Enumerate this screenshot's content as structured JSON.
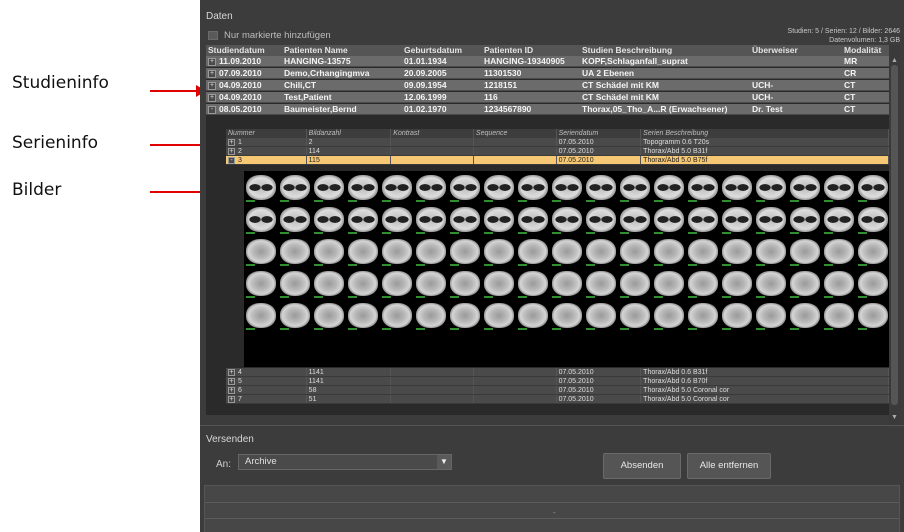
{
  "annotations": {
    "studieninfo": "Studieninfo",
    "serieninfo": "Serieninfo",
    "bilder": "Bilder"
  },
  "panel": {
    "data_title": "Daten",
    "checkbox_label": "Nur markierte hinzufügen",
    "stats_line1": "Studien: 5  /  Serien: 12  /  Bilder: 2646",
    "stats_line2": "Datenvolumen: 1,3 GB"
  },
  "study_table": {
    "headers": [
      "Studiendatum",
      "Patienten Name",
      "Geburtsdatum",
      "Patienten ID",
      "Studien Beschreibung",
      "Überweiser",
      "Modalität"
    ],
    "rows": [
      {
        "expander": "+",
        "date": "11.09.2010",
        "name": "HANGING-13575",
        "dob": "01.01.1934",
        "pid": "HANGING-19340905",
        "desc": "KOPF,Schlaganfall_suprat",
        "ref": "",
        "mod": "MR"
      },
      {
        "expander": "+",
        "date": "07.09.2010",
        "name": "Demo,Crhangingmva",
        "dob": "20.09.2005",
        "pid": "11301530",
        "desc": "UA 2 Ebenen",
        "ref": "",
        "mod": "CR"
      },
      {
        "expander": "+",
        "date": "04.09.2010",
        "name": "Chili,CT",
        "dob": "09.09.1954",
        "pid": "1218151",
        "desc": "CT Schädel mit KM",
        "ref": "UCH-",
        "mod": "CT"
      },
      {
        "expander": "+",
        "date": "04.09.2010",
        "name": "Test,Patient",
        "dob": "12.06.1999",
        "pid": "116",
        "desc": "CT Schädel mit KM",
        "ref": "UCH-",
        "mod": "CT"
      },
      {
        "expander": "-",
        "date": "08.05.2010",
        "name": "Baumeister,Bernd",
        "dob": "01.02.1970",
        "pid": "1234567890",
        "desc": "Thorax,05_Tho_A...R (Erwachsener)",
        "ref": "Dr. Test",
        "mod": "CT"
      }
    ]
  },
  "series_table": {
    "headers": [
      "Nummer",
      "Bildanzahl",
      "Kontrast",
      "Sequence",
      "Seriendatum",
      "Serien Beschreibung"
    ],
    "rows_top": [
      {
        "expander": "+",
        "num": "1",
        "count": "2",
        "contrast": "",
        "seq": "",
        "date": "07.05.2010",
        "desc": "Topogramm  0.6  T20s",
        "selected": false
      },
      {
        "expander": "+",
        "num": "2",
        "count": "114",
        "contrast": "",
        "seq": "",
        "date": "07.05.2010",
        "desc": "Thorax/Abd  5.0  B31f",
        "selected": false
      },
      {
        "expander": "-",
        "num": "3",
        "count": "115",
        "contrast": "",
        "seq": "",
        "date": "07.05.2010",
        "desc": "Thorax/Abd  5.0  B75f",
        "selected": true
      }
    ],
    "rows_bottom": [
      {
        "expander": "+",
        "num": "4",
        "count": "1141",
        "contrast": "",
        "seq": "",
        "date": "07.05.2010",
        "desc": "Thorax/Abd  0.6  B31f"
      },
      {
        "expander": "+",
        "num": "5",
        "count": "1141",
        "contrast": "",
        "seq": "",
        "date": "07.05.2010",
        "desc": "Thorax/Abd  0.6  B70f"
      },
      {
        "expander": "+",
        "num": "6",
        "count": "58",
        "contrast": "",
        "seq": "",
        "date": "07.05.2010",
        "desc": "Thorax/Abd  5.0  Coronal  cor"
      },
      {
        "expander": "+",
        "num": "7",
        "count": "51",
        "contrast": "",
        "seq": "",
        "date": "07.05.2010",
        "desc": "Thorax/Abd  5.0  Coronal  cor"
      }
    ]
  },
  "thumbnails": {
    "count": 95,
    "per_row": 19
  },
  "send": {
    "title": "Versenden",
    "to_label": "An:",
    "destination": "Archive",
    "send_button": "Absenden",
    "clear_button": "Alle entfernen",
    "footer_dot": "-"
  }
}
